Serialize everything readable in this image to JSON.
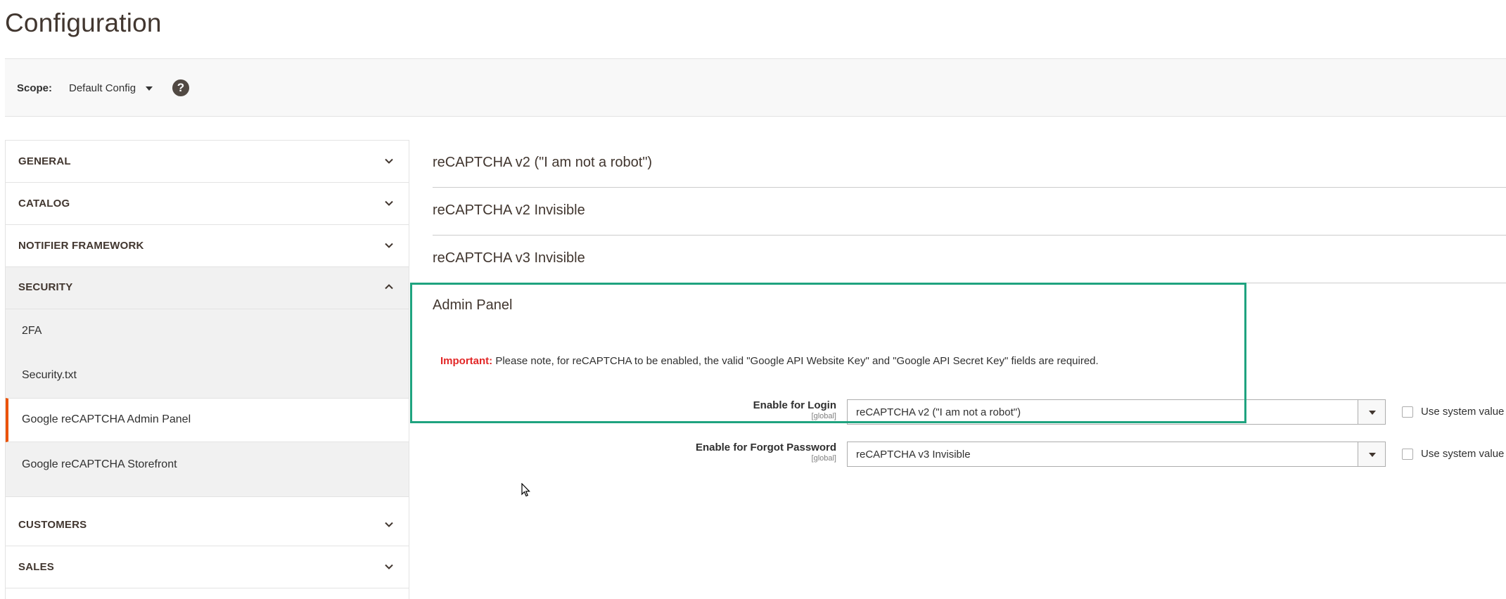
{
  "page": {
    "title": "Configuration"
  },
  "scope": {
    "label": "Scope:",
    "value": "Default Config",
    "help": "?"
  },
  "sidebar": {
    "tabs": [
      {
        "label": "GENERAL"
      },
      {
        "label": "CATALOG"
      },
      {
        "label": "NOTIFIER FRAMEWORK"
      },
      {
        "label": "SECURITY"
      },
      {
        "label": "CUSTOMERS"
      },
      {
        "label": "SALES"
      }
    ],
    "security_items": [
      {
        "label": "2FA"
      },
      {
        "label": "Security.txt"
      },
      {
        "label": "Google reCAPTCHA Admin Panel"
      },
      {
        "label": "Google reCAPTCHA Storefront"
      }
    ]
  },
  "main": {
    "sections": [
      {
        "title": "reCAPTCHA v2 (\"I am not a robot\")"
      },
      {
        "title": "reCAPTCHA v2 Invisible"
      },
      {
        "title": "reCAPTCHA v3 Invisible"
      }
    ],
    "admin_panel": {
      "title": "Admin Panel",
      "note_important": "Important:",
      "note_text": "Please note, for reCAPTCHA to be enabled, the valid \"Google API Website Key\" and \"Google API Secret Key\" fields are required.",
      "fields": [
        {
          "label": "Enable for Login",
          "scope": "[global]",
          "value": "reCAPTCHA v2 (\"I am not a robot\")",
          "system_label": "Use system value"
        },
        {
          "label": "Enable for Forgot Password",
          "scope": "[global]",
          "value": "reCAPTCHA v3 Invisible",
          "system_label": "Use system value"
        }
      ]
    }
  },
  "colors": {
    "active_accent": "#eb5202",
    "highlight": "#1fa37f",
    "important": "#e22626"
  }
}
